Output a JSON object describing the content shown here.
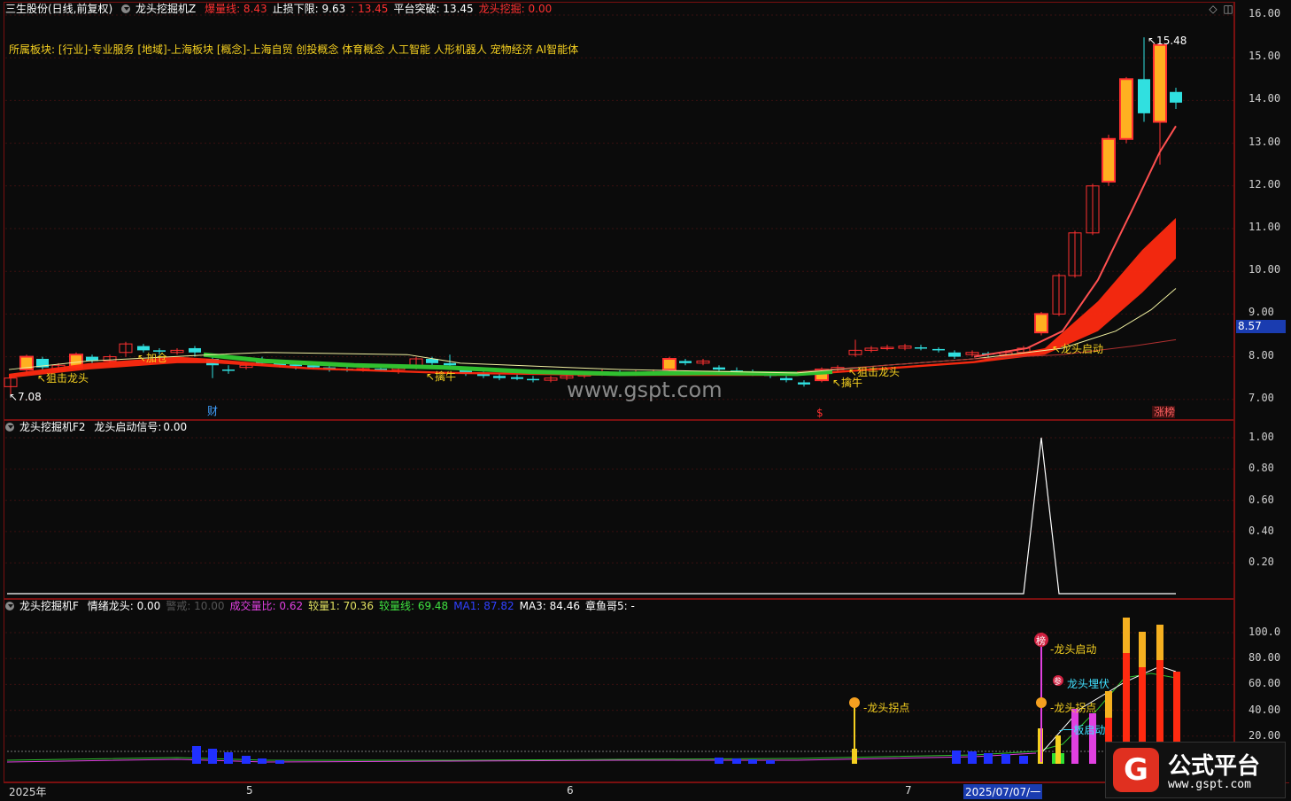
{
  "main": {
    "stock_name": "三生股份(日线,前复权)",
    "indicator": "龙头挖掘机Z",
    "items": [
      {
        "label": "爆量线:",
        "value": "8.43",
        "color": "#ff3030"
      },
      {
        "label": "止损下限:",
        "value": "9.63",
        "color": "#ffffff"
      },
      {
        "label": "",
        "value": ": 13.45",
        "color": "#ff3030"
      },
      {
        "label": "平台突破:",
        "value": "13.45",
        "color": "#ffffff"
      },
      {
        "label": "龙头挖掘:",
        "value": "0.00",
        "color": "#ff3030"
      }
    ],
    "sector_line": "所属板块: [行业]-专业服务 [地域]-上海板块 [概念]-上海自贸 创投概念 体育概念 人工智能 人形机器人 宠物经济 AI智能体",
    "yticks": [
      "16.00",
      "15.00",
      "14.00",
      "13.00",
      "12.00",
      "11.00",
      "10.00",
      "9.00",
      "8.00",
      "7.00"
    ],
    "price_tag": "8.57",
    "high_label": "15.48",
    "low_label": "7.08",
    "annotations": [
      "狙击龙头",
      "加仓",
      "擒牛",
      "擒牛",
      "狙击龙头",
      "龙头启动"
    ],
    "markers": {
      "cai": "财",
      "dollar": "$",
      "zhangbang": "涨榜"
    },
    "watermark": "www.gspt.com"
  },
  "panel2": {
    "indicator": "龙头挖掘机F2",
    "signal_label": "龙头启动信号:",
    "signal_value": "0.00",
    "yticks": [
      "1.00",
      "0.80",
      "0.60",
      "0.40",
      "0.20"
    ]
  },
  "panel3": {
    "indicator": "龙头挖掘机F",
    "items": [
      {
        "label": "情绪龙头:",
        "value": "0.00",
        "color": "#ffffff"
      },
      {
        "label": "警戒:",
        "value": "10.00",
        "color": "#555555"
      },
      {
        "label": "成交量比:",
        "value": "0.62",
        "color": "#e040e0"
      },
      {
        "label": "较量1:",
        "value": "70.36",
        "color": "#e0e060"
      },
      {
        "label": "较量线:",
        "value": "69.48",
        "color": "#40e040"
      },
      {
        "label": "MA1:",
        "value": "87.82",
        "color": "#3040ff"
      },
      {
        "label": "MA3:",
        "value": "84.46",
        "color": "#ffffff"
      },
      {
        "label": "章鱼哥5:",
        "value": "-",
        "color": "#ffffff"
      }
    ],
    "yticks": [
      "100.0",
      "80.00",
      "60.00",
      "40.00",
      "20.00"
    ],
    "annotations": [
      "龙头拐点",
      "龙头启动",
      "龙头埋伏",
      "龙头拐点",
      "一板启动"
    ],
    "badges": {
      "bang": "榜",
      "can": "参"
    }
  },
  "xaxis": {
    "labels": [
      "2025年",
      "5",
      "6",
      "7"
    ],
    "date_highlight": "2025/07/07/一"
  },
  "logo": {
    "mark": "G",
    "title": "公式平台",
    "url": "www.gspt.com"
  }
}
